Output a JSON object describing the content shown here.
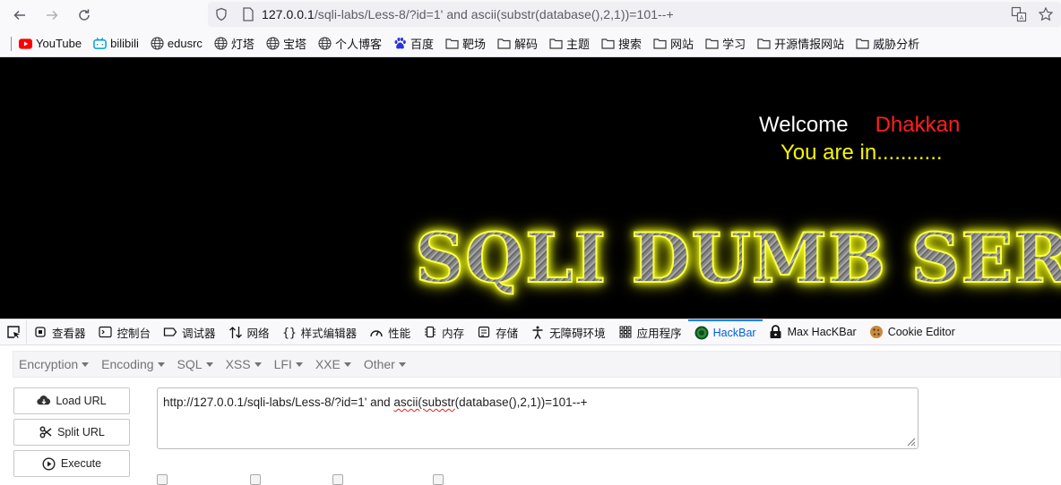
{
  "browser": {
    "url_host": "127.0.0.1",
    "url_rest": "/sqli-labs/Less-8/?id=1' and ascii(substr(database(),2,1))=101--+"
  },
  "bookmarks": [
    {
      "label": "YouTube",
      "icon": "youtube-icon"
    },
    {
      "label": "bilibili",
      "icon": "bilibili-icon"
    },
    {
      "label": "edusrc",
      "icon": "globe-icon"
    },
    {
      "label": "灯塔",
      "icon": "globe-icon"
    },
    {
      "label": "宝塔",
      "icon": "globe-icon"
    },
    {
      "label": "个人博客",
      "icon": "globe-icon"
    },
    {
      "label": "百度",
      "icon": "baidu-icon"
    },
    {
      "label": "靶场",
      "icon": "folder-icon"
    },
    {
      "label": "解码",
      "icon": "folder-icon"
    },
    {
      "label": "主题",
      "icon": "folder-icon"
    },
    {
      "label": "搜索",
      "icon": "folder-icon"
    },
    {
      "label": "网站",
      "icon": "folder-icon"
    },
    {
      "label": "学习",
      "icon": "folder-icon"
    },
    {
      "label": "开源情报网站",
      "icon": "folder-icon"
    },
    {
      "label": "威胁分析",
      "icon": "folder-icon"
    }
  ],
  "page": {
    "welcome": "Welcome",
    "user": "Dhakkan",
    "status": "You are in...........",
    "banner": "SQLI DUMB SERIES"
  },
  "devtools": {
    "tabs": [
      {
        "label": "查看器",
        "icon": "inspector-icon"
      },
      {
        "label": "控制台",
        "icon": "console-icon"
      },
      {
        "label": "调试器",
        "icon": "debugger-icon"
      },
      {
        "label": "网络",
        "icon": "network-icon"
      },
      {
        "label": "样式编辑器",
        "icon": "braces-icon"
      },
      {
        "label": "性能",
        "icon": "performance-icon"
      },
      {
        "label": "内存",
        "icon": "memory-icon"
      },
      {
        "label": "存储",
        "icon": "storage-icon"
      },
      {
        "label": "无障碍环境",
        "icon": "accessibility-icon"
      },
      {
        "label": "应用程序",
        "icon": "grid-icon"
      },
      {
        "label": "HackBar",
        "icon": "hackbar-icon",
        "active": true
      },
      {
        "label": "Max HacKBar",
        "icon": "lock-icon"
      },
      {
        "label": "Cookie Editor",
        "icon": "cookie-icon"
      }
    ]
  },
  "hackbar": {
    "menus": [
      "Encryption",
      "Encoding",
      "SQL",
      "XSS",
      "LFI",
      "XXE",
      "Other"
    ],
    "load_url": "Load URL",
    "split_url": "Split URL",
    "execute": "Execute",
    "url_before": "http://127.0.0.1/sqli-labs/Less-8/?id=1' and ",
    "url_mid": "ascii(substr",
    "url_after": "(database(),2,1))=101--+"
  },
  "colors": {
    "accent": "#0060df",
    "welcome_name": "#ff1e1e",
    "status_text": "#f6f600",
    "banner_glow": "#fbff43"
  }
}
